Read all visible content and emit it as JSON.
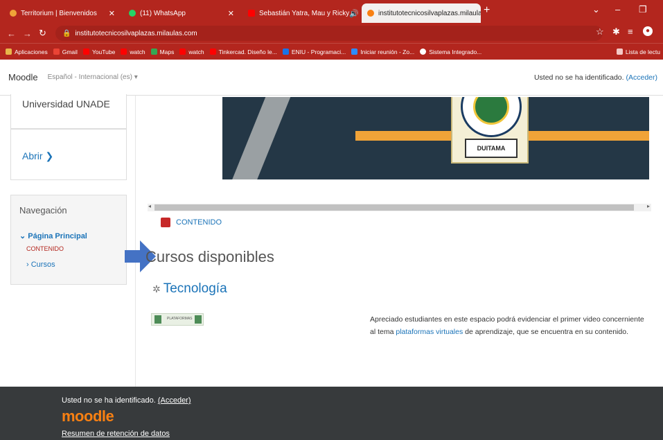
{
  "browser": {
    "tabs": [
      {
        "title": "Territorium | Bienvenidos",
        "color": "#f0a338"
      },
      {
        "title": "(11) WhatsApp",
        "color": "#25d366"
      },
      {
        "title": "Sebastián Yatra, Mau y Ricky",
        "color": "#ff0000"
      },
      {
        "title": "institutotecnicosilvaplazas.milaulas.",
        "color": "#f98012"
      }
    ],
    "url": "institutotecnicosilvaplazas.milaulas.com",
    "bookmarks": [
      {
        "label": "Aplicaciones",
        "color": "#e8b64a"
      },
      {
        "label": "Gmail",
        "color": "#ea4335"
      },
      {
        "label": "YouTube",
        "color": "#ff0000"
      },
      {
        "label": "watch",
        "color": "#ff0000"
      },
      {
        "label": "Maps",
        "color": "#34a853"
      },
      {
        "label": "watch",
        "color": "#ff0000"
      },
      {
        "label": "Tinkercad. Diseño le...",
        "color": "#ff0000"
      },
      {
        "label": "ENIU - Programaci...",
        "color": "#1a73e8"
      },
      {
        "label": "Iniciar reunión - Zo...",
        "color": "#2d8cff"
      },
      {
        "label": "Sistema Integrado...",
        "color": "#ffffff"
      }
    ],
    "reading_list": "Lista de lectu"
  },
  "header": {
    "logo": "Moodle",
    "language": "Español - Internacional (es) ▾",
    "login_text": "Usted no se ha identificado.",
    "login_link": "(Acceder)"
  },
  "left": {
    "university": "Universidad UNADE",
    "open": "Abrir ❯",
    "nav_title": "Navegación",
    "nav_home": "Página Principal",
    "nav_contenido": "CONTENIDO",
    "nav_cursos": "Cursos"
  },
  "main": {
    "crest_label": "DUITAMA",
    "content_link": "CONTENIDO",
    "heading": "Cursos disponibles",
    "course": "Tecnología",
    "thumb_label": "PLATAFORMAS",
    "desc_before": "Apreciado estudiantes en este espacio podrá evidenciar el primer video concerniente al tema ",
    "desc_link": "plataformas virtuales",
    "desc_after": " de aprendizaje, que se encuentra en su contenido."
  },
  "footer": {
    "login_text": "Usted no se ha identificado.",
    "login_link": "(Acceder)",
    "logo": "moodle",
    "retention": "Resumen de retención de datos"
  }
}
